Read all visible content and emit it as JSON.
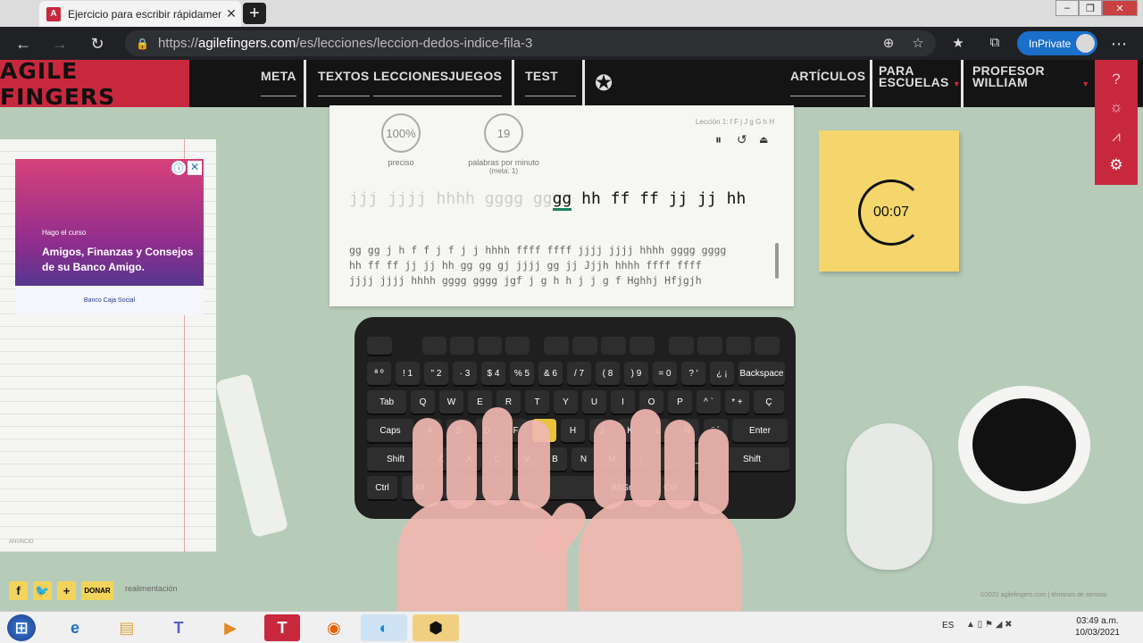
{
  "browser": {
    "tab_title": "Ejercicio para escribir rápidamente",
    "tab_favicon": "A",
    "url_prefix": "https://",
    "url_host": "agilefingers.com",
    "url_path": "/es/lecciones/leccion-dedos-indice-fila-3",
    "inprivate": "InPrivate"
  },
  "site": {
    "logo": "AGILE FINGERS",
    "nav": {
      "meta": "META",
      "textos": "TEXTOS",
      "lecciones": "LECCIONES",
      "juegos": "JUEGOS",
      "test": "TEST",
      "articulos": "ARTÍCULOS",
      "para_escuelas_1": "PARA",
      "para_escuelas_2": "ESCUELAS",
      "profesor_1": "PROFESOR",
      "profesor_2": "WILLIAM"
    },
    "accent": "#c8283e"
  },
  "ad": {
    "small": "Hago el curso",
    "line1": "Amigos, Finanzas y Consejos",
    "line2": "de su Banco Amigo.",
    "sponsor": "Banco Caja Social",
    "label": "ANUNCIO"
  },
  "lesson": {
    "accuracy": "100%",
    "accuracy_label": "preciso",
    "wpm": "19",
    "wpm_label": "palabras por minuto",
    "wpm_sub": "(meta: 1)",
    "title": "Lección 1: f F j J g G h H",
    "typed": "jjj jjjj hhhh gggg gg",
    "current": "gg",
    "remaining": " hh ff ff jj jj hh",
    "para_line1": "gg gg j h f f j f j j hhhh ffff ffff jjjj jjjj hhhh gggg gggg",
    "para_line2": "hh ff ff jj jj hh gg gg gj jjjj gg jj Jjjh hhhh ffff ffff",
    "para_line3": "jjjj jjjj hhhh gggg gggg jgf j g h h j j g f Hghhj Hfjgjh"
  },
  "timer": "00:07",
  "keyboard": {
    "row1": [
      "ª º",
      "! 1",
      "\" 2",
      "· 3",
      "$ 4",
      "% 5",
      "& 6",
      "/ 7",
      "( 8",
      ") 9",
      "= 0",
      "? '",
      "¿ ¡",
      "Backspace"
    ],
    "row2": [
      "Tab",
      "Q",
      "W",
      "E",
      "R",
      "T",
      "Y",
      "U",
      "I",
      "O",
      "P",
      "^ `",
      "* +",
      "Ç"
    ],
    "row3": [
      "Caps",
      "A",
      "S",
      "D",
      "F",
      "G",
      "H",
      "J",
      "K",
      "L",
      "Ñ",
      "¨ ´",
      "Enter"
    ],
    "row4": [
      "Shift",
      "Z",
      "X",
      "C",
      "V",
      "B",
      "N",
      "M",
      ";",
      ":",
      "_",
      "Shift"
    ],
    "row5": [
      "Ctrl",
      "Alt",
      "",
      "AltGr",
      "Ctrl"
    ]
  },
  "footer": {
    "donar": "DONAR",
    "feedback": "realimentación",
    "copyright": "©2021 agilefingers.com | términos de servicio"
  },
  "taskbar": {
    "lang": "ES",
    "time": "03:49 a.m.",
    "date": "10/03/2021"
  }
}
